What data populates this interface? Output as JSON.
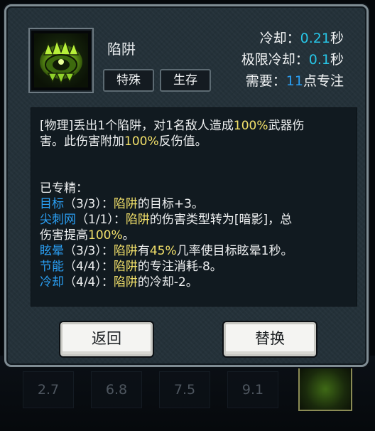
{
  "skill": {
    "name": "陷阱",
    "tags": [
      "特殊",
      "生存"
    ],
    "icon": "spiked-trap-icon"
  },
  "stats": {
    "cooldown_label": "冷却：",
    "cooldown_value": "0.21",
    "cooldown_unit": "秒",
    "limit_cooldown_label": "极限冷却：",
    "limit_cooldown_value": "0.1",
    "limit_cooldown_unit": "秒",
    "require_label": "需要：",
    "require_value": "11",
    "require_unit": "点专注"
  },
  "description": {
    "line1_a": "[物理]丢出1个陷阱，对1名敌人造成",
    "line1_pct": "100%",
    "line1_b": "武器伤",
    "line2_a": "害。此伤害附加",
    "line2_pct": "100%",
    "line2_b": "反伤值。"
  },
  "specialized": {
    "header": "已专精：",
    "items": [
      {
        "name": "目标",
        "rank": "（3/3）：",
        "skill": "陷阱",
        "text": "的目标+3。"
      },
      {
        "name": "尖刺网",
        "rank": "（1/1）：",
        "skill": "陷阱",
        "text": "的伤害类型转为[暗影]，总",
        "text2a": "伤害提高",
        "pct": "100%",
        "text2b": "。"
      },
      {
        "name": "眩晕",
        "rank": "（3/3）：",
        "skill": "陷阱",
        "text_a": "有",
        "pct": "45%",
        "text_b": "几率使目标眩晕1秒。"
      },
      {
        "name": "节能",
        "rank": "（4/4）：",
        "skill": "陷阱",
        "text": "的专注消耗-8。"
      },
      {
        "name": "冷却",
        "rank": "（4/4）：",
        "skill": "陷阱",
        "text": "的冷却-2。"
      }
    ]
  },
  "buttons": {
    "back": "返回",
    "replace": "替换"
  },
  "skillbar": {
    "slots": [
      "2.7",
      "6.8",
      "7.5",
      "9.1"
    ]
  },
  "colors": {
    "accent_cyan": "#27c5e6",
    "accent_blue": "#2a9ff3",
    "highlight_yellow": "#f2e06a"
  }
}
